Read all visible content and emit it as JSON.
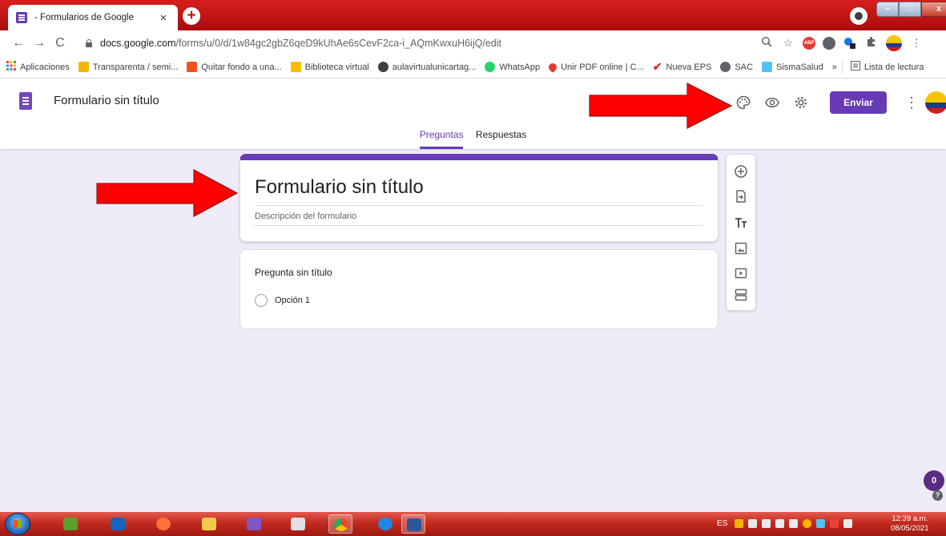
{
  "browser": {
    "tab_title": "- Formularios de Google",
    "tab_close": "×",
    "new_tab": "+",
    "window_buttons": {
      "minimize": "–",
      "maximize": "□",
      "close": "x"
    },
    "nav": {
      "back": "←",
      "forward": "→",
      "reload": "C"
    },
    "url_host": "docs.google.com",
    "url_path": "/forms/u/0/d/1w84gc2gbZ6qeD9kUhAe6sCevF2ca-i_AQmKwxuH6ijQ/edit",
    "toolbar_icons": [
      "zoom-icon",
      "star-icon",
      "adblock-icon",
      "extension-icon",
      "extension-icon",
      "puzzle-icon",
      "profile-avatar",
      "menu-icon"
    ],
    "abp_label": "ABP"
  },
  "bookmarks": [
    {
      "label": "Aplicaciones",
      "color": "#ea4335"
    },
    {
      "label": "Transparenta / semi...",
      "color": "#f4b400"
    },
    {
      "label": "Quitar fondo a una...",
      "color": "#f4511e"
    },
    {
      "label": "Biblioteca virtual",
      "color": "#fbbc04"
    },
    {
      "label": "aulavirtualunicartag...",
      "color": "#3c4043"
    },
    {
      "label": "WhatsApp",
      "color": "#25d366"
    },
    {
      "label": "Unir PDF online | C...",
      "color": "#e53935"
    },
    {
      "label": "Nueva EPS",
      "color": "#d32f2f"
    },
    {
      "label": "SAC",
      "color": "#5f6368"
    },
    {
      "label": "SismaSalud",
      "color": "#4fc3f7"
    }
  ],
  "bookmarks_more": "»",
  "reading_list": "Lista de lectura",
  "forms": {
    "doc_title": "Formulario sin título",
    "send_label": "Enviar",
    "more": "⋮",
    "tabs": {
      "questions": "Preguntas",
      "responses": "Respuestas"
    },
    "form_title": "Formulario sin título",
    "form_description": "Descripción del formulario",
    "question_title": "Pregunta sin título",
    "option_1": "Opción 1",
    "help_count": "0",
    "help_q": "?"
  },
  "taskbar": {
    "language": "ES",
    "time": "12:39 a.m.",
    "date": "08/05/2021"
  },
  "colors": {
    "accent": "#673ab7",
    "arrow": "#ff0000",
    "chrome_frame": "#c01414",
    "background": "#f0ebf8"
  }
}
